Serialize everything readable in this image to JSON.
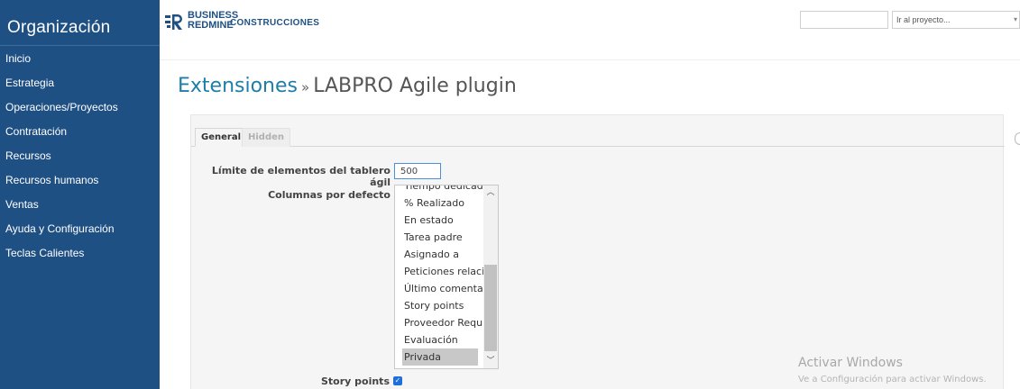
{
  "sidebar": {
    "title": "Organización",
    "items": [
      {
        "label": "Inicio"
      },
      {
        "label": "Estrategia"
      },
      {
        "label": "Operaciones/Proyectos"
      },
      {
        "label": "Contratación"
      },
      {
        "label": "Recursos"
      },
      {
        "label": "Recursos humanos"
      },
      {
        "label": "Ventas"
      },
      {
        "label": "Ayuda y Configuración"
      },
      {
        "label": "Teclas Calientes"
      }
    ]
  },
  "header": {
    "logo_line1": "BUSINESS",
    "logo_line2": "REDMINE",
    "project_name": "CONSTRUCCIONES",
    "search_value": "",
    "project_select": "Ir al proyecto...",
    "brand_color": "#1f5084"
  },
  "main": {
    "title_link": "Extensiones",
    "title_separator": "»",
    "title_current": "LABPRO Agile plugin",
    "tabs": [
      {
        "label": "General",
        "active": true
      },
      {
        "label": "Hidden",
        "active": false
      }
    ],
    "fields": {
      "board_limit_label": "Límite de elementos del tablero ágil",
      "board_limit_value": "500",
      "default_columns_label": "Columnas por defecto",
      "story_points_label": "Story points",
      "story_points_checked": true
    },
    "column_options": [
      {
        "label": "Tiempo dedicado",
        "selected": false
      },
      {
        "label": "% Realizado",
        "selected": false
      },
      {
        "label": "En estado",
        "selected": false
      },
      {
        "label": "Tarea padre",
        "selected": false
      },
      {
        "label": "Asignado a",
        "selected": false
      },
      {
        "label": "Peticiones relacio",
        "selected": false
      },
      {
        "label": "Último comentar",
        "selected": false
      },
      {
        "label": "Story points",
        "selected": false
      },
      {
        "label": "Proveedor Requi:",
        "selected": false
      },
      {
        "label": "Evaluación",
        "selected": false
      },
      {
        "label": "Privada",
        "selected": true
      }
    ]
  },
  "watermark": {
    "title": "Activar Windows",
    "subtitle": "Ve a Configuración para activar Windows."
  }
}
